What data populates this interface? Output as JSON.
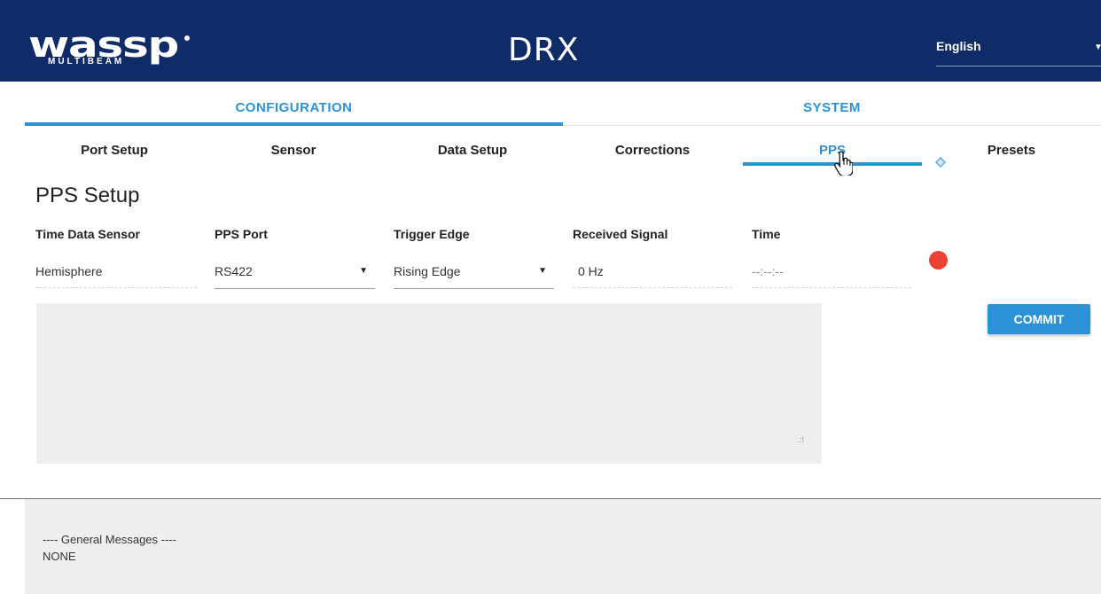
{
  "header": {
    "logo_text": "wassp",
    "logo_subtext": "MULTIBEAM",
    "product": "DRX",
    "language": "English"
  },
  "tab_groups": {
    "configuration": "CONFIGURATION",
    "system": "SYSTEM"
  },
  "subtabs": [
    {
      "label": "Port Setup"
    },
    {
      "label": "Sensor"
    },
    {
      "label": "Data Setup"
    },
    {
      "label": "Corrections"
    },
    {
      "label": "PPS",
      "active": true
    },
    {
      "label": "Presets"
    }
  ],
  "pps": {
    "title": "PPS Setup",
    "columns": {
      "time_data_sensor": "Time Data Sensor",
      "pps_port": "PPS Port",
      "trigger_edge": "Trigger Edge",
      "received_signal": "Received Signal",
      "time": "Time"
    },
    "values": {
      "time_data_sensor": "Hemisphere",
      "pps_port": "RS422",
      "trigger_edge": "Rising Edge",
      "received_signal": "0 Hz",
      "time": "--:--:--"
    },
    "status_color": "#ea4335"
  },
  "commit_label": "COMMIT",
  "messages": {
    "heading": "---- General Messages ----",
    "body": "NONE"
  },
  "colors": {
    "header_bg": "#0f2b68",
    "accent": "#2b92d8"
  }
}
